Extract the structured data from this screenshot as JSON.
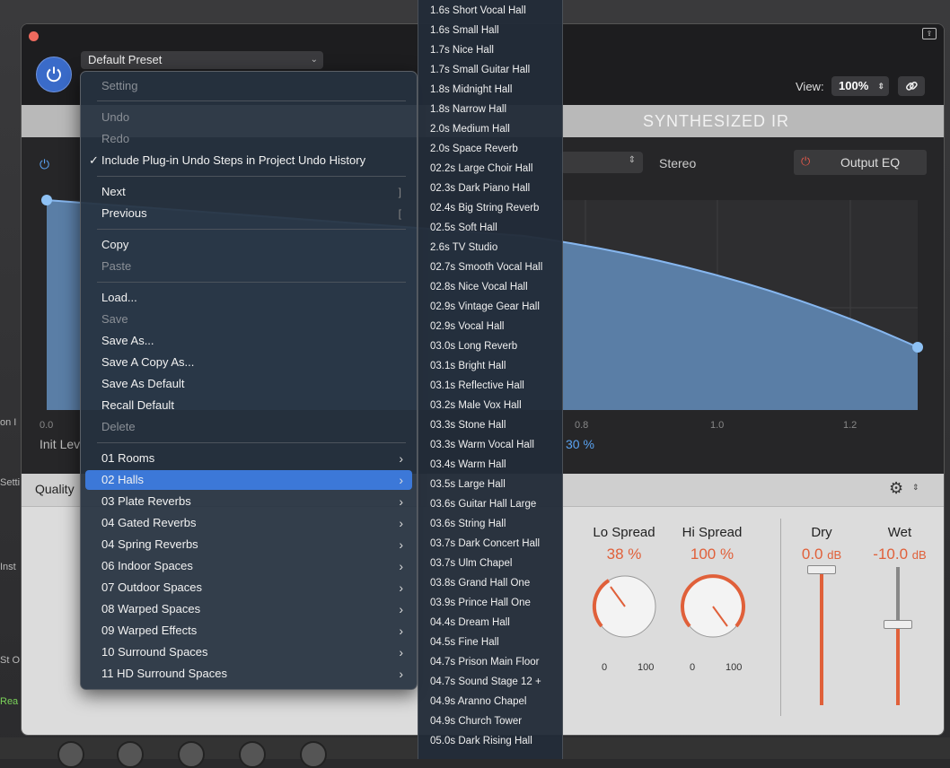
{
  "daw": {
    "side_labels": [
      "on I",
      "Setti",
      "Inst",
      "St O",
      "Rea"
    ]
  },
  "plugin": {
    "preset": "Default Preset",
    "view_label": "View:",
    "view_value": "100%",
    "ir_title": "SYNTHESIZED IR",
    "stereo_label": "Stereo",
    "output_eq_label": "Output EQ",
    "graph": {
      "x_ticks": [
        "0.0",
        "0.8",
        "1.0",
        "1.2"
      ],
      "init_level_label": "Init Lev",
      "value_label": "30 %"
    },
    "quality_label": "Quality",
    "knobs": [
      {
        "title": "Lo Spread",
        "value": "38 %",
        "min": "0",
        "max": "100",
        "level": 0.38
      },
      {
        "title": "Hi Spread",
        "value": "100 %",
        "min": "0",
        "max": "100",
        "level": 1.0
      }
    ],
    "sliders": [
      {
        "title": "Dry",
        "value": "0.0",
        "unit": "dB"
      },
      {
        "title": "Wet",
        "value": "-10.0",
        "unit": "dB"
      }
    ]
  },
  "menu": {
    "setting": "Setting",
    "undo": "Undo",
    "redo": "Redo",
    "include_undo": "Include Plug-in Undo Steps in Project Undo History",
    "include_undo_check": "✓",
    "next": "Next",
    "next_shortcut": "]",
    "previous": "Previous",
    "previous_shortcut": "[",
    "copy": "Copy",
    "paste": "Paste",
    "load": "Load...",
    "save": "Save",
    "save_as": "Save As...",
    "save_copy_as": "Save A Copy As...",
    "save_as_default": "Save As Default",
    "recall_default": "Recall Default",
    "delete": "Delete",
    "categories": [
      "01 Rooms",
      "02 Halls",
      "03 Plate Reverbs",
      "04 Gated Reverbs",
      "04 Spring Reverbs",
      "06 Indoor Spaces",
      "07 Outdoor Spaces",
      "08 Warped Spaces",
      "09 Warped Effects",
      "10 Surround Spaces",
      "11 HD Surround Spaces"
    ]
  },
  "submenu": {
    "items": [
      "1.6s Short Vocal Hall",
      "1.6s Small Hall",
      "1.7s Nice Hall",
      "1.7s Small Guitar Hall",
      "1.8s Midnight Hall",
      "1.8s Narrow Hall",
      "2.0s Medium Hall",
      "2.0s Space Reverb",
      "02.2s Large Choir Hall",
      "02.3s Dark Piano Hall",
      "02.4s Big String Reverb",
      "02.5s Soft Hall",
      "2.6s TV Studio",
      "02.7s Smooth Vocal Hall",
      "02.8s Nice Vocal Hall",
      "02.9s Vintage Gear Hall",
      "02.9s Vocal Hall",
      "03.0s Long Reverb",
      "03.1s Bright Hall",
      "03.1s Reflective Hall",
      "03.2s Male Vox Hall",
      "03.3s Stone Hall",
      "03.3s Warm Vocal Hall",
      "03.4s Warm Hall",
      "03.5s Large Hall",
      "03.6s Guitar Hall Large",
      "03.6s String Hall",
      "03.7s Dark Concert Hall",
      "03.7s Ulm Chapel",
      "03.8s Grand Hall One",
      "03.9s Prince Hall One",
      "04.4s Dream Hall",
      "04.5s Fine Hall",
      "04.7s Prison Main Floor",
      "04.7s Sound Stage 12 +",
      "04.9s Aranno Chapel",
      "04.9s Church Tower",
      "05.0s Dark Rising Hall"
    ]
  }
}
